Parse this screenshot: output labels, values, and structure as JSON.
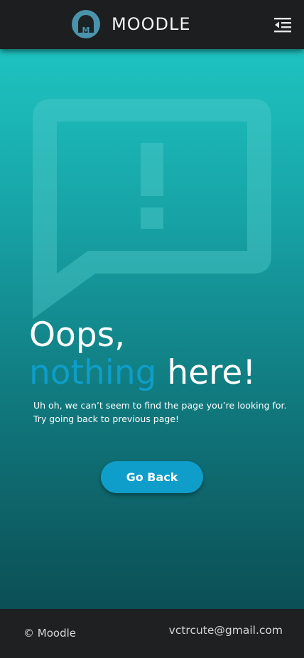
{
  "header": {
    "brand": "MOODLE",
    "logo_letter": "M",
    "logo_icon": "moodle-logo-icon",
    "menu_icon": "menu-collapse-icon"
  },
  "error": {
    "icon": "alert-speech-bubble-icon",
    "headline_line1": "Oops,",
    "headline_highlight": "nothing",
    "headline_rest": "here!",
    "description_line1": "Uh oh, we can’t seem to find the page you’re looking for.",
    "description_line2": "Try going back to previous page!",
    "button_label": "Go Back"
  },
  "footer": {
    "copyright": "© Moodle",
    "email": "vctrcute@gmail.com"
  },
  "colors": {
    "header_bg": "#1c1e1f",
    "accent": "#0f9dc9",
    "gradient_top": "#1ec3c1",
    "gradient_bottom": "#0b4f55",
    "footer_bg": "#1f2021"
  }
}
